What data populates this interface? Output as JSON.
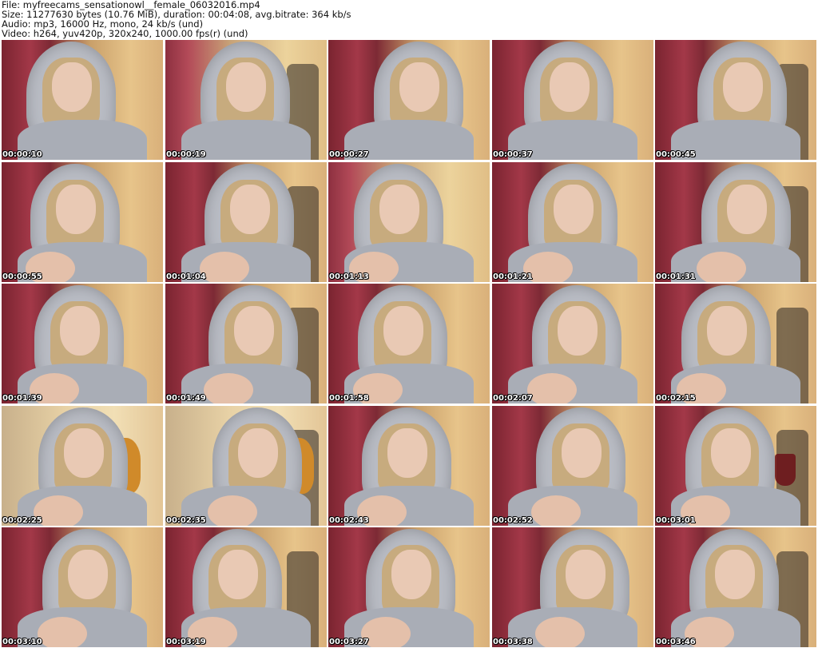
{
  "header": {
    "file_line": "File: myfreecams_sensationowl__female_06032016.mp4",
    "size_line": "Size: 11277630 bytes (10.76 MiB), duration: 00:04:08, avg.bitrate: 364 kb/s",
    "audio_line": "Audio: mp3, 16000 Hz, mono, 24 kb/s (und)",
    "video_line": "Video: h264, yuv420p, 320x240, 1000.00 fps(r) (und)"
  },
  "thumbnails": [
    {
      "timestamp": "00:00:10"
    },
    {
      "timestamp": "00:00:19"
    },
    {
      "timestamp": "00:00:27"
    },
    {
      "timestamp": "00:00:37"
    },
    {
      "timestamp": "00:00:45"
    },
    {
      "timestamp": "00:00:55"
    },
    {
      "timestamp": "00:01:04"
    },
    {
      "timestamp": "00:01:13"
    },
    {
      "timestamp": "00:01:21"
    },
    {
      "timestamp": "00:01:31"
    },
    {
      "timestamp": "00:01:39"
    },
    {
      "timestamp": "00:01:49"
    },
    {
      "timestamp": "00:01:58"
    },
    {
      "timestamp": "00:02:07"
    },
    {
      "timestamp": "00:02:15"
    },
    {
      "timestamp": "00:02:25"
    },
    {
      "timestamp": "00:02:35"
    },
    {
      "timestamp": "00:02:43"
    },
    {
      "timestamp": "00:02:52"
    },
    {
      "timestamp": "00:03:01"
    },
    {
      "timestamp": "00:03:10"
    },
    {
      "timestamp": "00:03:19"
    },
    {
      "timestamp": "00:03:27"
    },
    {
      "timestamp": "00:03:38"
    },
    {
      "timestamp": "00:03:46"
    }
  ]
}
